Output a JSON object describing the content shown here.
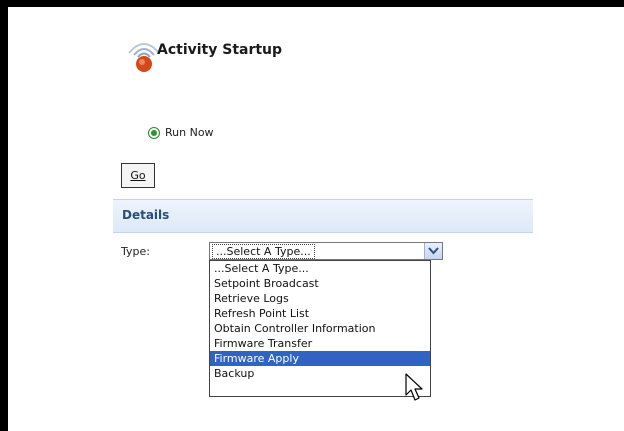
{
  "page": {
    "title": "Activity Startup"
  },
  "startup": {
    "run_now_label": "Run Now",
    "go_label": "Go"
  },
  "details": {
    "heading": "Details",
    "type_label": "Type:",
    "type_value": "...Select A Type..."
  },
  "type_options": [
    "...Select A Type...",
    "Setpoint Broadcast",
    "Retrieve Logs",
    "Refresh Point List",
    "Obtain Controller Information",
    "Firmware Transfer",
    "Firmware Apply",
    "Backup"
  ],
  "highlighted_option": "Firmware Apply",
  "colors": {
    "highlight": "#3163c5",
    "details_text": "#2b4d7a",
    "radio": "#2a9a2a"
  }
}
